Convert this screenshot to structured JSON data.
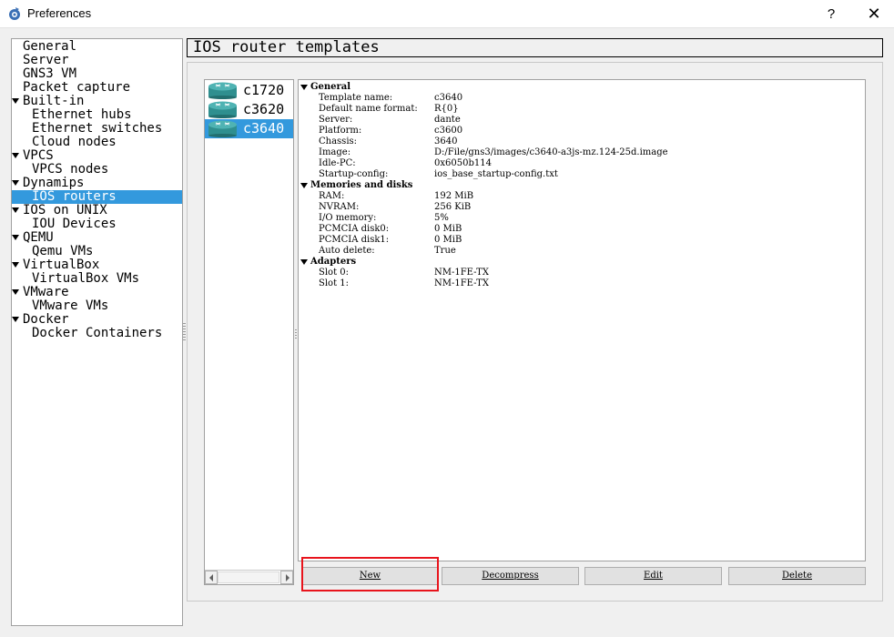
{
  "window": {
    "title": "Preferences",
    "help_label": "?",
    "close_label": "✕"
  },
  "sidebar": {
    "items": [
      {
        "label": "General",
        "level": 0,
        "expandable": false
      },
      {
        "label": "Server",
        "level": 0,
        "expandable": false
      },
      {
        "label": "GNS3 VM",
        "level": 0,
        "expandable": false
      },
      {
        "label": "Packet capture",
        "level": 0,
        "expandable": false
      },
      {
        "label": "Built-in",
        "level": 0,
        "expandable": true
      },
      {
        "label": "Ethernet hubs",
        "level": 1,
        "expandable": false
      },
      {
        "label": "Ethernet switches",
        "level": 1,
        "expandable": false
      },
      {
        "label": "Cloud nodes",
        "level": 1,
        "expandable": false
      },
      {
        "label": "VPCS",
        "level": 0,
        "expandable": true
      },
      {
        "label": "VPCS nodes",
        "level": 1,
        "expandable": false
      },
      {
        "label": "Dynamips",
        "level": 0,
        "expandable": true
      },
      {
        "label": "IOS routers",
        "level": 1,
        "expandable": false,
        "selected": true
      },
      {
        "label": "IOS on UNIX",
        "level": 0,
        "expandable": true
      },
      {
        "label": "IOU Devices",
        "level": 1,
        "expandable": false
      },
      {
        "label": "QEMU",
        "level": 0,
        "expandable": true
      },
      {
        "label": "Qemu VMs",
        "level": 1,
        "expandable": false
      },
      {
        "label": "VirtualBox",
        "level": 0,
        "expandable": true
      },
      {
        "label": "VirtualBox VMs",
        "level": 1,
        "expandable": false
      },
      {
        "label": "VMware",
        "level": 0,
        "expandable": true
      },
      {
        "label": "VMware VMs",
        "level": 1,
        "expandable": false
      },
      {
        "label": "Docker",
        "level": 0,
        "expandable": true
      },
      {
        "label": "Docker Containers",
        "level": 1,
        "expandable": false
      }
    ]
  },
  "page": {
    "title": "IOS router templates"
  },
  "templates": {
    "items": [
      {
        "label": "c1720",
        "icon": "router-icon"
      },
      {
        "label": "c3620",
        "icon": "router-icon"
      },
      {
        "label": "c3640",
        "icon": "router-icon",
        "selected": true
      }
    ]
  },
  "details": {
    "groups": [
      {
        "label": "General",
        "rows": [
          {
            "key": "Template name:",
            "value": "c3640"
          },
          {
            "key": "Default name format:",
            "value": "R{0}"
          },
          {
            "key": "Server:",
            "value": "dante"
          },
          {
            "key": "Platform:",
            "value": "c3600"
          },
          {
            "key": "Chassis:",
            "value": "3640"
          },
          {
            "key": "Image:",
            "value": "D:/File/gns3/images/c3640-a3js-mz.124-25d.image"
          },
          {
            "key": "Idle-PC:",
            "value": "0x6050b114"
          },
          {
            "key": "Startup-config:",
            "value": "ios_base_startup-config.txt"
          }
        ]
      },
      {
        "label": "Memories and disks",
        "rows": [
          {
            "key": "RAM:",
            "value": "192 MiB"
          },
          {
            "key": "NVRAM:",
            "value": "256 KiB"
          },
          {
            "key": "I/O memory:",
            "value": "5%"
          },
          {
            "key": "PCMCIA disk0:",
            "value": "0 MiB"
          },
          {
            "key": "PCMCIA disk1:",
            "value": "0 MiB"
          },
          {
            "key": "Auto delete:",
            "value": "True"
          }
        ]
      },
      {
        "label": "Adapters",
        "rows": [
          {
            "key": "Slot 0:",
            "value": "NM-1FE-TX"
          },
          {
            "key": "Slot 1:",
            "value": "NM-1FE-TX"
          }
        ]
      }
    ]
  },
  "buttons": {
    "new_label": "New",
    "decompress_label": "Decompress",
    "edit_label": "Edit",
    "delete_label": "Delete"
  },
  "colors": {
    "selection": "#3399dd",
    "highlight_box": "#e8141c",
    "router_icon": "#2f8f8f"
  }
}
